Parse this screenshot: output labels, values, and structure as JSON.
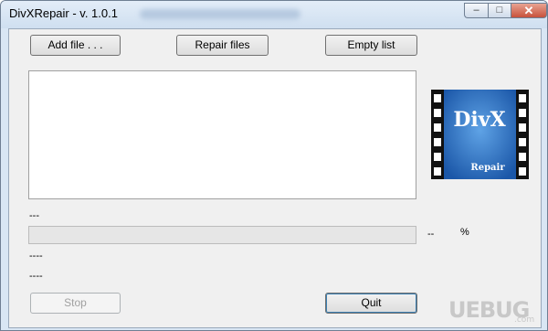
{
  "window": {
    "title": "DivXRepair - v. 1.0.1",
    "minimize_glyph": "–",
    "maximize_glyph": "□",
    "close_glyph": "✕"
  },
  "toolbar": {
    "add_label": "Add file . . .",
    "repair_label": "Repair files",
    "empty_label": "Empty list"
  },
  "file_list": {
    "items": []
  },
  "logo": {
    "text": "DivX",
    "subtext": "Repair",
    "bg": "#1f63b8",
    "film": "#111111"
  },
  "status": {
    "line1": "---",
    "progress_value": "--",
    "progress_unit": "%",
    "progress_fraction": 0,
    "line2": "----",
    "line3": "----"
  },
  "footer": {
    "stop_label": "Stop",
    "quit_label": "Quit"
  },
  "watermark": {
    "text": "UEBUG",
    "sub": ".com"
  }
}
